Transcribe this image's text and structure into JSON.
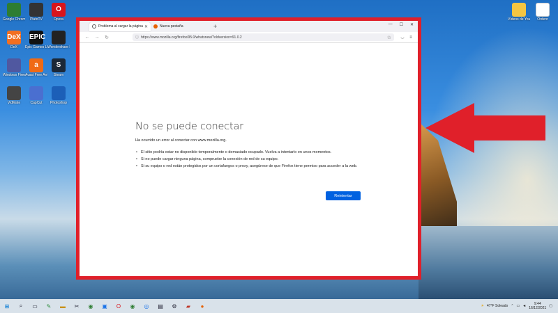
{
  "desktop": {
    "icons": [
      {
        "label": "Google Chrome",
        "glyph": "",
        "color": "#2e7d32",
        "icon": "chrome-icon"
      },
      {
        "label": "PlutoTV",
        "glyph": "",
        "color": "#333",
        "icon": "app-icon"
      },
      {
        "label": "Opera",
        "glyph": "O",
        "color": "#d8151b",
        "icon": "opera-icon"
      },
      {
        "label": "DeX",
        "glyph": "DeX",
        "color": "#f36f21",
        "icon": "dex-icon"
      },
      {
        "label": "Epic Games Launcher",
        "glyph": "EPIC",
        "color": "#111",
        "icon": "epic-icon"
      },
      {
        "label": "Wondershare Filmora",
        "glyph": "",
        "color": "#222",
        "icon": "filmora-icon"
      },
      {
        "label": "Windows Firewall",
        "glyph": "",
        "color": "#5058a0",
        "icon": "app-icon"
      },
      {
        "label": "Avast Free Antivirus",
        "glyph": "a",
        "color": "#f06a15",
        "icon": "avast-icon"
      },
      {
        "label": "Steam",
        "glyph": "S",
        "color": "#1b2838",
        "icon": "steam-icon"
      },
      {
        "label": "VidMate",
        "glyph": "",
        "color": "#444",
        "icon": "app-icon"
      },
      {
        "label": "CapCut",
        "glyph": "",
        "color": "#4a6fd0",
        "icon": "app-icon"
      },
      {
        "label": "Photoshop",
        "glyph": "",
        "color": "#1c5fb8",
        "icon": "app-icon"
      }
    ],
    "right_icons": [
      {
        "label": "Vídeos de Youtub",
        "icon": "folder-icon"
      },
      {
        "label": "Ordenr",
        "icon": "file-icon"
      }
    ]
  },
  "browser": {
    "tabs": [
      {
        "title": "Problema al cargar la página",
        "active": true
      },
      {
        "title": "Nueva pestaña",
        "active": false
      }
    ],
    "new_tab_symbol": "+",
    "window_controls": {
      "minimize": "—",
      "maximize": "☐",
      "close": "✕"
    },
    "url": "https://www.mozilla.org/firefox/95.0/whatsnew/?oldversion=91.0.2"
  },
  "error": {
    "title": "No se puede conectar",
    "intro": "Ha ocurrido un error al conectar con www.mozilla.org.",
    "bullets": [
      "El sitio podría estar no disponible temporalmente o demasiado ocupado. Vuelva a intentarlo en unos momentos.",
      "Si no puede cargar ninguna página, compruebe la conexión de red de su equipo.",
      "Si su equipo o red están protegidos por un cortafuegos o proxy, asegúrese de que Firefox tiene permiso para acceder a la web."
    ],
    "retry_label": "Reintentar"
  },
  "taskbar": {
    "weather": "47°F Soleado",
    "time": "9:44",
    "date": "16/12/2021"
  },
  "colors": {
    "annotation": "#e0202a",
    "button": "#0061e0"
  }
}
